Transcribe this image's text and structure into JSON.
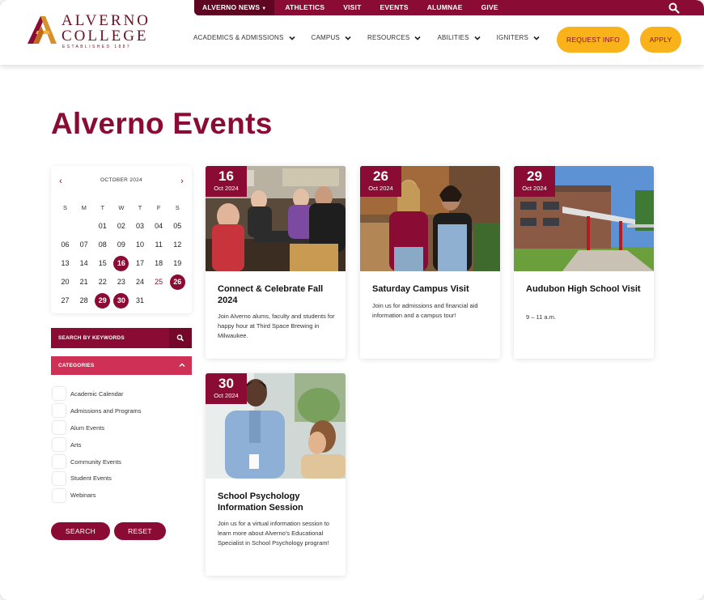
{
  "utility_nav": {
    "items": [
      {
        "label": "ALVERNO NEWS",
        "active": true
      },
      {
        "label": "ATHLETICS"
      },
      {
        "label": "VISIT"
      },
      {
        "label": "EVENTS"
      },
      {
        "label": "ALUMNAE"
      },
      {
        "label": "GIVE"
      }
    ],
    "search_icon": "search-icon"
  },
  "logo": {
    "line1": "ALVERNO",
    "line2": "COLLEGE",
    "line3": "ESTABLISHED 1887"
  },
  "main_nav": [
    {
      "label": "ACADEMICS & ADMISSIONS"
    },
    {
      "label": "CAMPUS"
    },
    {
      "label": "RESOURCES"
    },
    {
      "label": "ABILITIES"
    },
    {
      "label": "IGNITERS"
    }
  ],
  "cta": {
    "request_info": "REQUEST INFO",
    "apply": "APPLY"
  },
  "page_title": "Alverno Events",
  "calendar": {
    "month_label": "OCTOBER 2024",
    "prev_icon": "chevron-left-icon",
    "next_icon": "chevron-right-icon",
    "weekdays": [
      "S",
      "M",
      "T",
      "W",
      "T",
      "F",
      "S"
    ],
    "weeks": [
      [
        "",
        "",
        "01",
        "02",
        "03",
        "04",
        "05"
      ],
      [
        "06",
        "07",
        "08",
        "09",
        "10",
        "11",
        "12"
      ],
      [
        "13",
        "14",
        "15",
        "16",
        "17",
        "18",
        "19"
      ],
      [
        "20",
        "21",
        "22",
        "23",
        "24",
        "25",
        "26"
      ],
      [
        "27",
        "28",
        "29",
        "30",
        "31",
        "",
        ""
      ]
    ],
    "event_days": [
      "16",
      "26",
      "29",
      "30"
    ],
    "today": "25"
  },
  "filters": {
    "keyword_label": "SEARCH BY KEYWORDS",
    "categories_label": "CATEGORIES",
    "categories": [
      "Academic Calendar",
      "Admissions and Programs",
      "Alum Events",
      "Arts",
      "Community Events",
      "Student Events",
      "Webinars"
    ],
    "search_button": "SEARCH",
    "reset_button": "RESET"
  },
  "events": [
    {
      "day": "16",
      "month": "Oct 2024",
      "title": "Connect & Celebrate Fall 2024",
      "description": "Join Alverno alums, faculty and students for happy hour at Third Space Brewing in Milwaukee."
    },
    {
      "day": "26",
      "month": "Oct 2024",
      "title": "Saturday Campus Visit",
      "description": "Join us for admissions and financial aid information and a campus tour!"
    },
    {
      "day": "29",
      "month": "Oct 2024",
      "title": "Audubon High School Visit",
      "description": "9 – 11 a.m."
    },
    {
      "day": "30",
      "month": "Oct 2024",
      "title": "School Psychology Information Session",
      "description": "Join us for a virtual information session to learn more about Alverno's Educational Specialist in School Psychology program!"
    }
  ],
  "colors": {
    "brand": "#8a0c35",
    "accent": "#f9b21a",
    "category_bar": "#cf3056"
  }
}
